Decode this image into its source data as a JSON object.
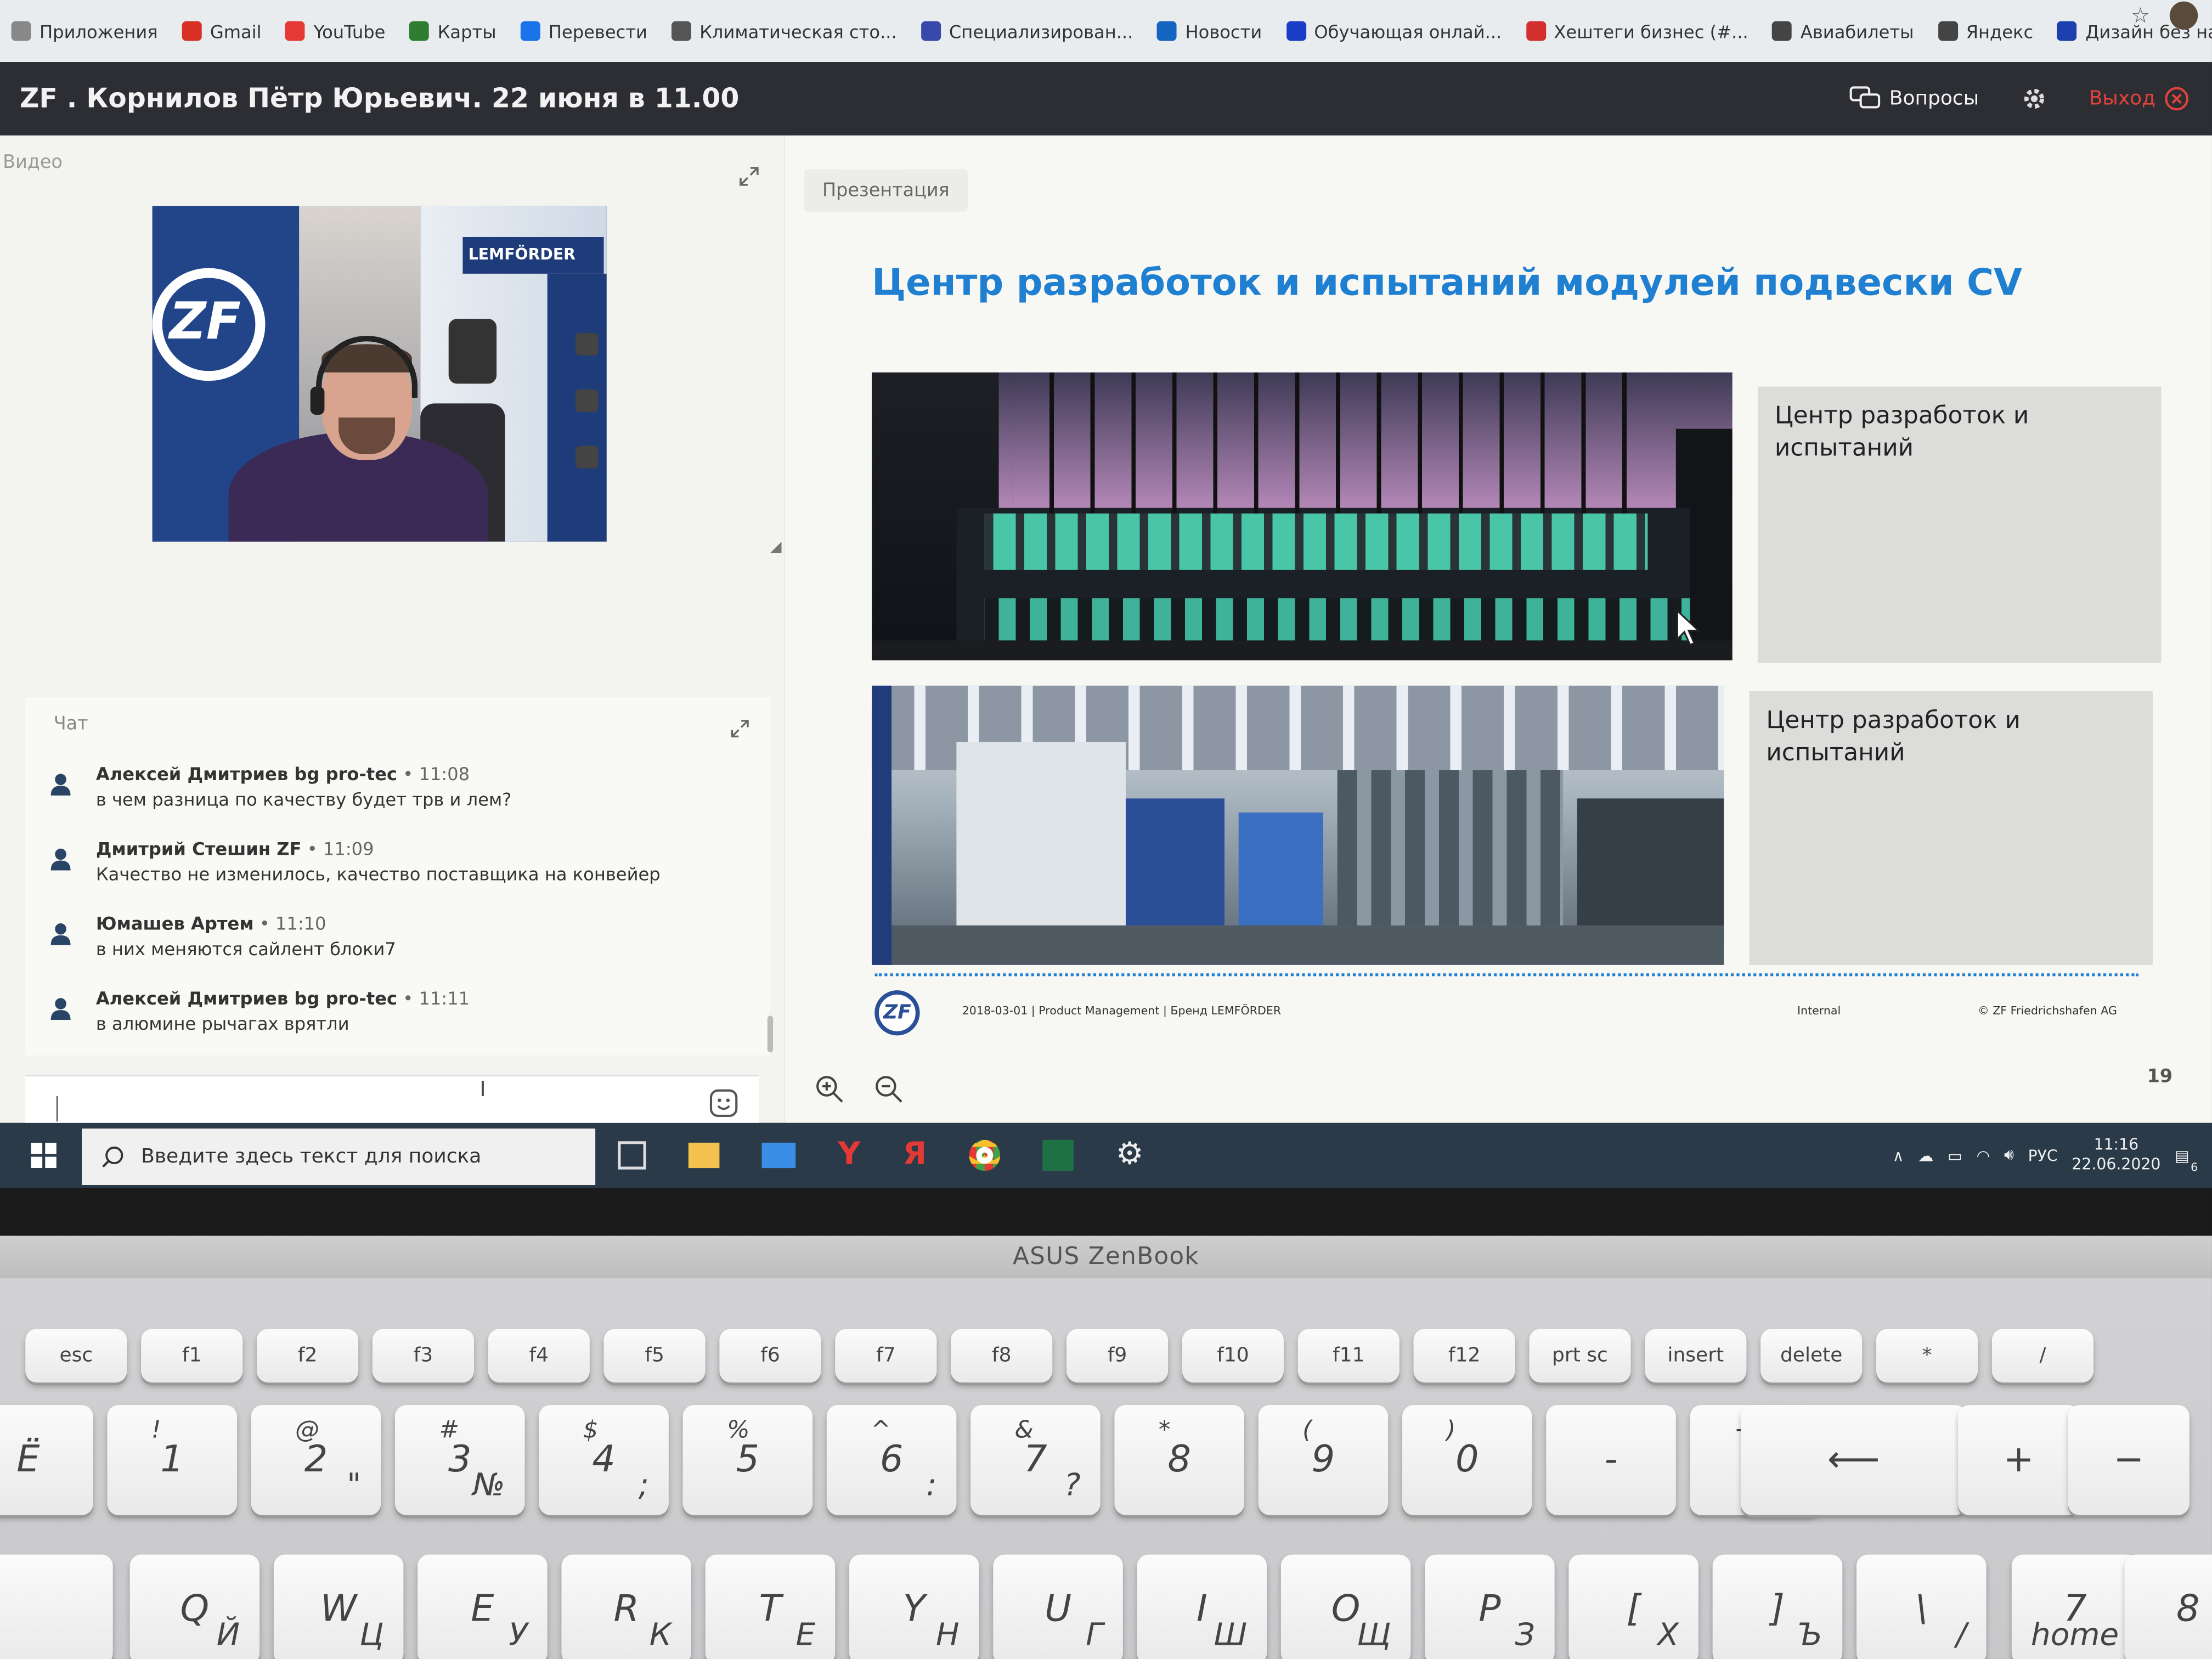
{
  "bookmarks": [
    "Приложения",
    "Gmail",
    "YouTube",
    "Карты",
    "Перевести",
    "Климатическая сто...",
    "Специализирован...",
    "Новости",
    "Обучающая онлай...",
    "Хештеги бизнес (#...",
    "Авиабилеты",
    "Яндекс",
    "Дизайн без назван..."
  ],
  "header": {
    "title": "ZF . Корнилов Пётр Юрьевич. 22 июня в 11.00",
    "questions": "Вопросы",
    "exit": "Выход"
  },
  "video": {
    "label": "Видео",
    "poster_brand": "LEMFÖRDER",
    "poster_logo": "ZF"
  },
  "chat": {
    "label": "Чат",
    "messages": [
      {
        "author": "Алексей Дмитриев bg pro-tec",
        "time": "• 11:08",
        "text": "в чем разница по качеству будет трв и лем?"
      },
      {
        "author": "Дмитрий Стешин ZF",
        "time": "• 11:09",
        "text": "Качество не изменилось, качество поставщика на конвейер"
      },
      {
        "author": "Юмашев Артем",
        "time": "• 11:10",
        "text": "в них меняются сайлент блоки7"
      },
      {
        "author": "Алексей Дмитриев bg pro-tec",
        "time": "• 11:11",
        "text": "в алюмине рычагах врятли"
      }
    ]
  },
  "presentation": {
    "tab": "Презентация",
    "title": "Центр разработок и испытаний модулей подвески CV",
    "caption1": "Центр разработок и испытаний",
    "caption2": "Центр разработок и испытаний",
    "footer_logo": "ZF",
    "footer_left": "2018-03-01 | Product Management | Бренд LEMFÖRDER",
    "footer_mid": "Internal",
    "footer_right": "© ZF Friedrichshafen AG",
    "page": "19"
  },
  "taskbar": {
    "search_placeholder": "Введите здесь текст для поиска",
    "lang": "РУС",
    "time": "11:16",
    "date": "22.06.2020",
    "notifications": "6"
  },
  "laptop": {
    "brand": "ASUS ZenBook",
    "fkeys": [
      "esc",
      "f1",
      "f2",
      "f3",
      "f4",
      "f5",
      "f6",
      "f7",
      "f8",
      "f9",
      "f10",
      "f11",
      "f12",
      "prt sc",
      "insert",
      "delete",
      "*",
      "/"
    ],
    "numrow": [
      {
        "top": "",
        "main": "Ё",
        "alt": ""
      },
      {
        "top": "!",
        "main": "1",
        "alt": ""
      },
      {
        "top": "@",
        "main": "2",
        "alt": "\""
      },
      {
        "top": "#",
        "main": "3",
        "alt": "№"
      },
      {
        "top": "$",
        "main": "4",
        "alt": ";"
      },
      {
        "top": "%",
        "main": "5",
        "alt": ""
      },
      {
        "top": "^",
        "main": "6",
        "alt": ":"
      },
      {
        "top": "&",
        "main": "7",
        "alt": "?"
      },
      {
        "top": "*",
        "main": "8",
        "alt": ""
      },
      {
        "top": "(",
        "main": "9",
        "alt": ""
      },
      {
        "top": ")",
        "main": "0",
        "alt": ""
      },
      {
        "top": "",
        "main": "-",
        "alt": ""
      },
      {
        "top": "+",
        "main": "=",
        "alt": ""
      }
    ],
    "plus": "+",
    "minus": "−",
    "qrow": [
      {
        "main": "Q",
        "alt": "Й"
      },
      {
        "main": "W",
        "alt": "Ц"
      },
      {
        "main": "E",
        "alt": "У"
      },
      {
        "main": "R",
        "alt": "К"
      },
      {
        "main": "T",
        "alt": "Е"
      },
      {
        "main": "Y",
        "alt": "Н"
      },
      {
        "main": "U",
        "alt": "Г"
      },
      {
        "main": "I",
        "alt": "Ш"
      },
      {
        "main": "O",
        "alt": "Щ"
      },
      {
        "main": "P",
        "alt": "З"
      },
      {
        "main": "[",
        "alt": "Х"
      },
      {
        "main": "]",
        "alt": "Ъ"
      },
      {
        "main": "\\",
        "alt": "/"
      }
    ],
    "num7": {
      "main": "7",
      "sub": "home"
    },
    "num8": {
      "main": "8",
      "sub": ""
    }
  },
  "colors": {
    "accent": "#1f7fd1",
    "exit": "#e2423b",
    "titlebar": "#2c2e33",
    "taskbar": "#2a3a49"
  }
}
